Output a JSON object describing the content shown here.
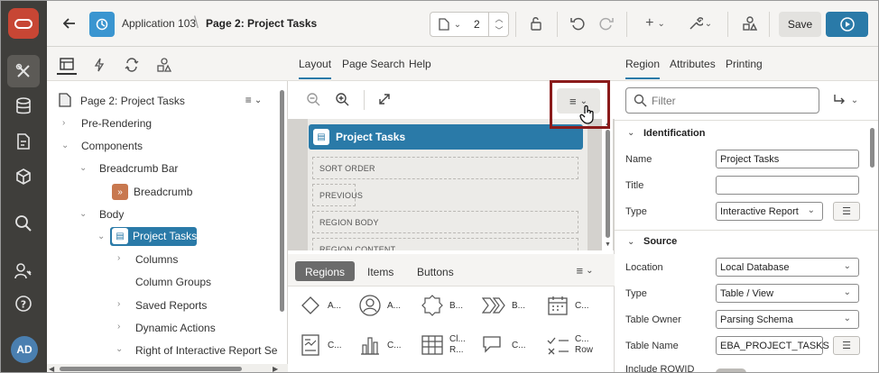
{
  "topbar": {
    "app_name": "Application 103",
    "separator": "\\",
    "page_name": "Page 2: Project Tasks",
    "page_number": "2",
    "save_label": "Save"
  },
  "user": {
    "initials": "AD"
  },
  "left_pane": {
    "header": "Page 2: Project Tasks",
    "tree": [
      {
        "label": "Pre-Rendering"
      },
      {
        "label": "Components"
      },
      {
        "label": "Breadcrumb Bar"
      },
      {
        "label": "Breadcrumb"
      },
      {
        "label": "Body"
      },
      {
        "label": "Project Tasks"
      },
      {
        "label": "Columns"
      },
      {
        "label": "Column Groups"
      },
      {
        "label": "Saved Reports"
      },
      {
        "label": "Dynamic Actions"
      },
      {
        "label": "Right of Interactive Report Searc"
      }
    ]
  },
  "mid_pane": {
    "tabs": [
      "Layout",
      "Page Search",
      "Help"
    ],
    "region_title": "Project Tasks",
    "slots": [
      "SORT ORDER",
      "PREVIOUS",
      "REGION BODY",
      "REGION CONTENT"
    ],
    "bottom_tabs": [
      "Regions",
      "Items",
      "Buttons"
    ],
    "components": [
      {
        "label": "A...",
        "icon": "diamond-icon"
      },
      {
        "label": "A...",
        "icon": "avatar-icon"
      },
      {
        "label": "B...",
        "icon": "badge-icon"
      },
      {
        "label": "B...",
        "icon": "breadcrumb-icon"
      },
      {
        "label": "C...",
        "icon": "calendar-icon"
      },
      {
        "label": "C...",
        "icon": "card-icon"
      },
      {
        "label": "C...",
        "icon": "chart-icon"
      },
      {
        "label": "Cl... R...",
        "icon": "classic-report-icon"
      },
      {
        "label": "C...",
        "icon": "comments-icon"
      },
      {
        "label": "C... Row",
        "icon": "content-row-icon"
      }
    ]
  },
  "right_pane": {
    "tabs": [
      "Region",
      "Attributes",
      "Printing"
    ],
    "filter_placeholder": "Filter",
    "identification": {
      "heading": "Identification",
      "name_label": "Name",
      "name_value": "Project Tasks",
      "title_label": "Title",
      "title_value": "",
      "type_label": "Type",
      "type_value": "Interactive Report"
    },
    "source": {
      "heading": "Source",
      "location_label": "Location",
      "location_value": "Local Database",
      "type_label": "Type",
      "type_value": "Table / View",
      "owner_label": "Table Owner",
      "owner_value": "Parsing Schema",
      "table_label": "Table Name",
      "table_value": "EBA_PROJECT_TASKS",
      "rowid_label": "Include ROWID"
    }
  }
}
